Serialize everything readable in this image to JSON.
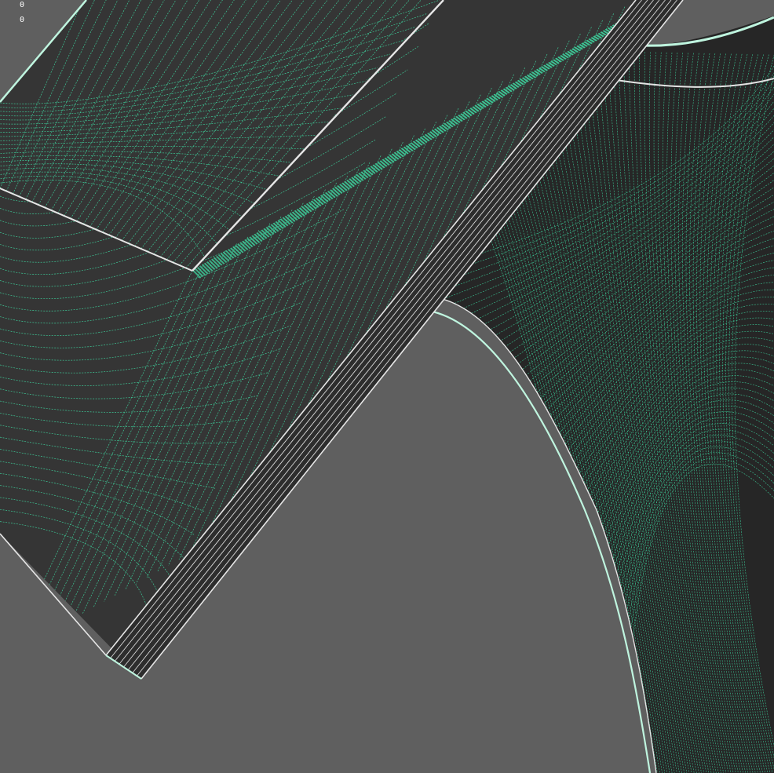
{
  "viewport": {
    "background": "#5f5f5f",
    "wire_color": "#3fe0a6",
    "edge_color": "#e4e4e4",
    "surface_color": "#363636",
    "right_surface_color": "#262626"
  },
  "stats": {
    "line1": "0",
    "line2": "0"
  }
}
